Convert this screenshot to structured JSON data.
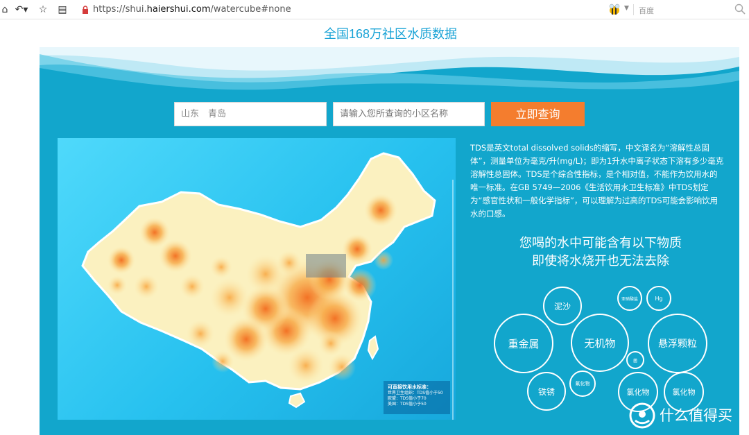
{
  "browser": {
    "url_prefix": "https://shui.",
    "url_domain": "haiershui.com",
    "url_suffix": "/watercube#none",
    "search_engine": "百度"
  },
  "page": {
    "title": "全国168万社区水质数据"
  },
  "search_form": {
    "region_value": "山东　青岛",
    "community_placeholder": "请输入您所查询的小区名称",
    "query_button": "立即查询"
  },
  "map": {
    "legend_title": "可直接饮用水标准：",
    "legend_rows": [
      "世界卫生组织：TDS值小于50",
      "欧盟：TDS值小于70",
      "美国：TDS值小于50"
    ]
  },
  "description": "TDS是英文total dissolved solids的缩写，中文译名为“溶解性总固体”，测量单位为毫克/升(mg/L)；即为1升水中离子状态下溶有多少毫克溶解性总固体。TDS是个综合性指标，是个相对值，不能作为饮用水的唯一标准。在GB 5749—2006《生活饮用水卫生标准》中TDS划定为“感官性状和一般化学指标”，可以理解为过高的TDS可能会影响饮用水的口感。",
  "headline": {
    "line1": "您喝的水中可能含有以下物质",
    "line2": "即使将水烧开也无法去除"
  },
  "substances": {
    "mud": "泥沙",
    "organics": "亚硝酸盐",
    "hg": "Hg",
    "heavy_metal": "重金属",
    "inorganic": "无机物",
    "suspended": "悬浮颗粒",
    "small": "菌",
    "fluoride": "氟化物",
    "rust": "铁锈",
    "chloride": "氯化物",
    "chloride2": "氯化物"
  },
  "watermark": {
    "text": "什么值得买"
  }
}
